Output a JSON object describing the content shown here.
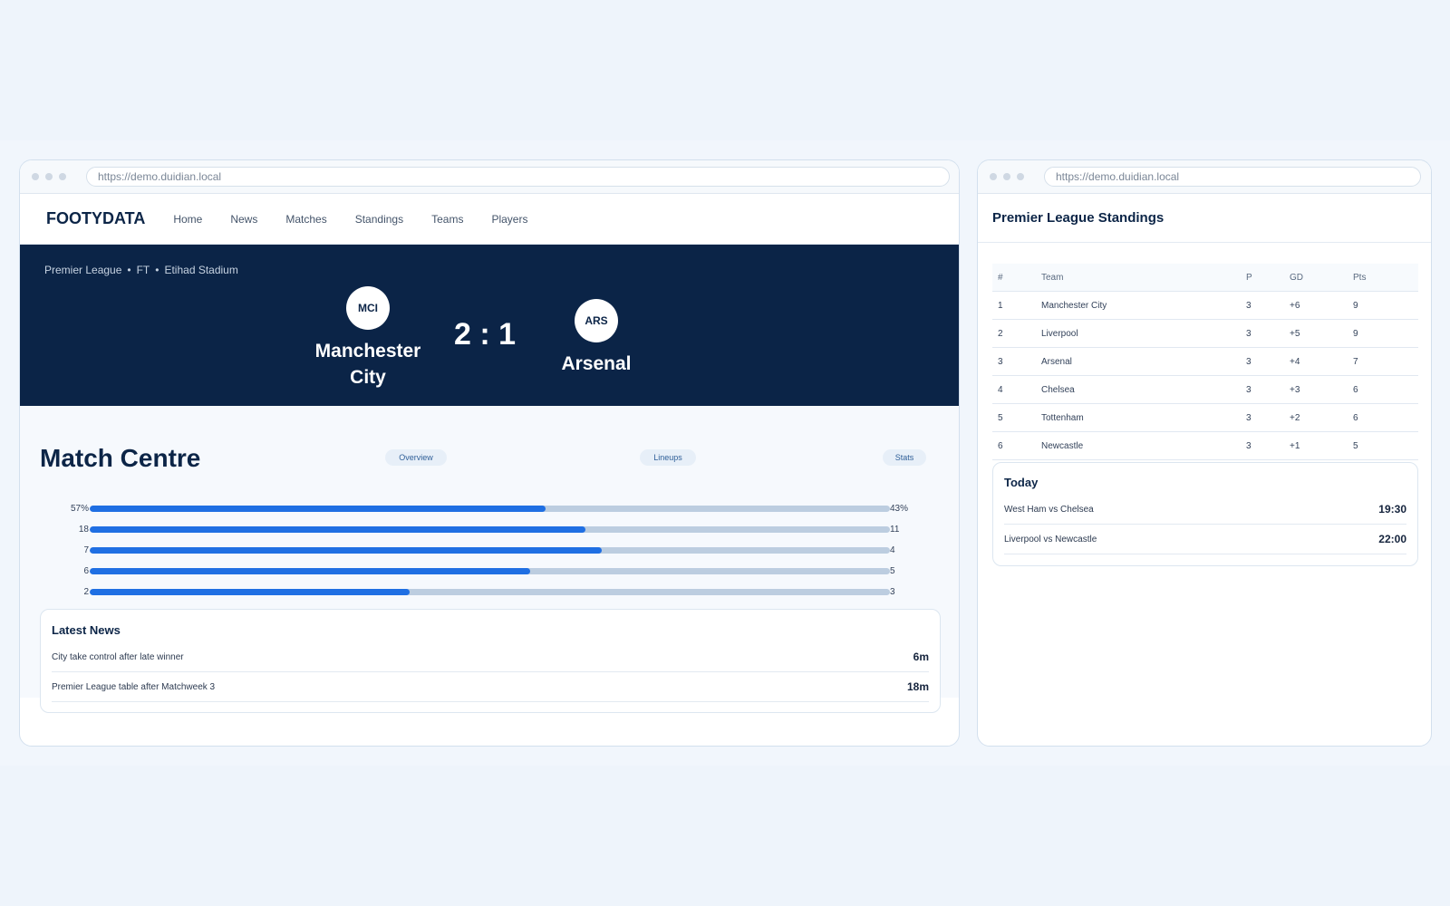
{
  "left_window": {
    "url": "https://demo.duidian.local",
    "nav": {
      "brand": "FOOTYDATA",
      "items": [
        "Home",
        "News",
        "Matches",
        "Standings",
        "Teams",
        "Players"
      ]
    },
    "match": {
      "competition": "Premier League",
      "status": "FT",
      "venue": "Etihad Stadium",
      "home": {
        "code": "MCI",
        "name": "Manchester City"
      },
      "away": {
        "code": "ARS",
        "name": "Arsenal"
      },
      "score": "2 : 1"
    },
    "match_centre": {
      "title": "Match Centre",
      "tabs": [
        "Overview",
        "Lineups",
        "Stats"
      ],
      "stats": [
        {
          "home": "57%",
          "away": "43%",
          "home_share": 0.57
        },
        {
          "home": "18",
          "away": "11",
          "home_share": 0.62
        },
        {
          "home": "7",
          "away": "4",
          "home_share": 0.64
        },
        {
          "home": "6",
          "away": "5",
          "home_share": 0.55
        },
        {
          "home": "2",
          "away": "3",
          "home_share": 0.4
        }
      ]
    },
    "latest_news": {
      "title": "Latest News",
      "items": [
        {
          "headline": "City take control after late winner",
          "time": "6m"
        },
        {
          "headline": "Premier League table after Matchweek 3",
          "time": "18m"
        }
      ]
    }
  },
  "right_window": {
    "url": "https://demo.duidian.local",
    "title": "Premier League Standings",
    "table": {
      "headers": [
        "#",
        "Team",
        "P",
        "GD",
        "Pts"
      ],
      "rows": [
        [
          "1",
          "Manchester City",
          "3",
          "+6",
          "9"
        ],
        [
          "2",
          "Liverpool",
          "3",
          "+5",
          "9"
        ],
        [
          "3",
          "Arsenal",
          "3",
          "+4",
          "7"
        ],
        [
          "4",
          "Chelsea",
          "3",
          "+3",
          "6"
        ],
        [
          "5",
          "Tottenham",
          "3",
          "+2",
          "6"
        ],
        [
          "6",
          "Newcastle",
          "3",
          "+1",
          "5"
        ]
      ]
    },
    "today": {
      "title": "Today",
      "fixtures": [
        {
          "match": "West Ham vs Chelsea",
          "time": "19:30"
        },
        {
          "match": "Liverpool vs Newcastle",
          "time": "22:00"
        }
      ]
    }
  },
  "colors": {
    "navy": "#0b2447",
    "accent_blue": "#1f6fe3",
    "bar_track": "#bccde0",
    "page_bg": "#eef4fb"
  }
}
